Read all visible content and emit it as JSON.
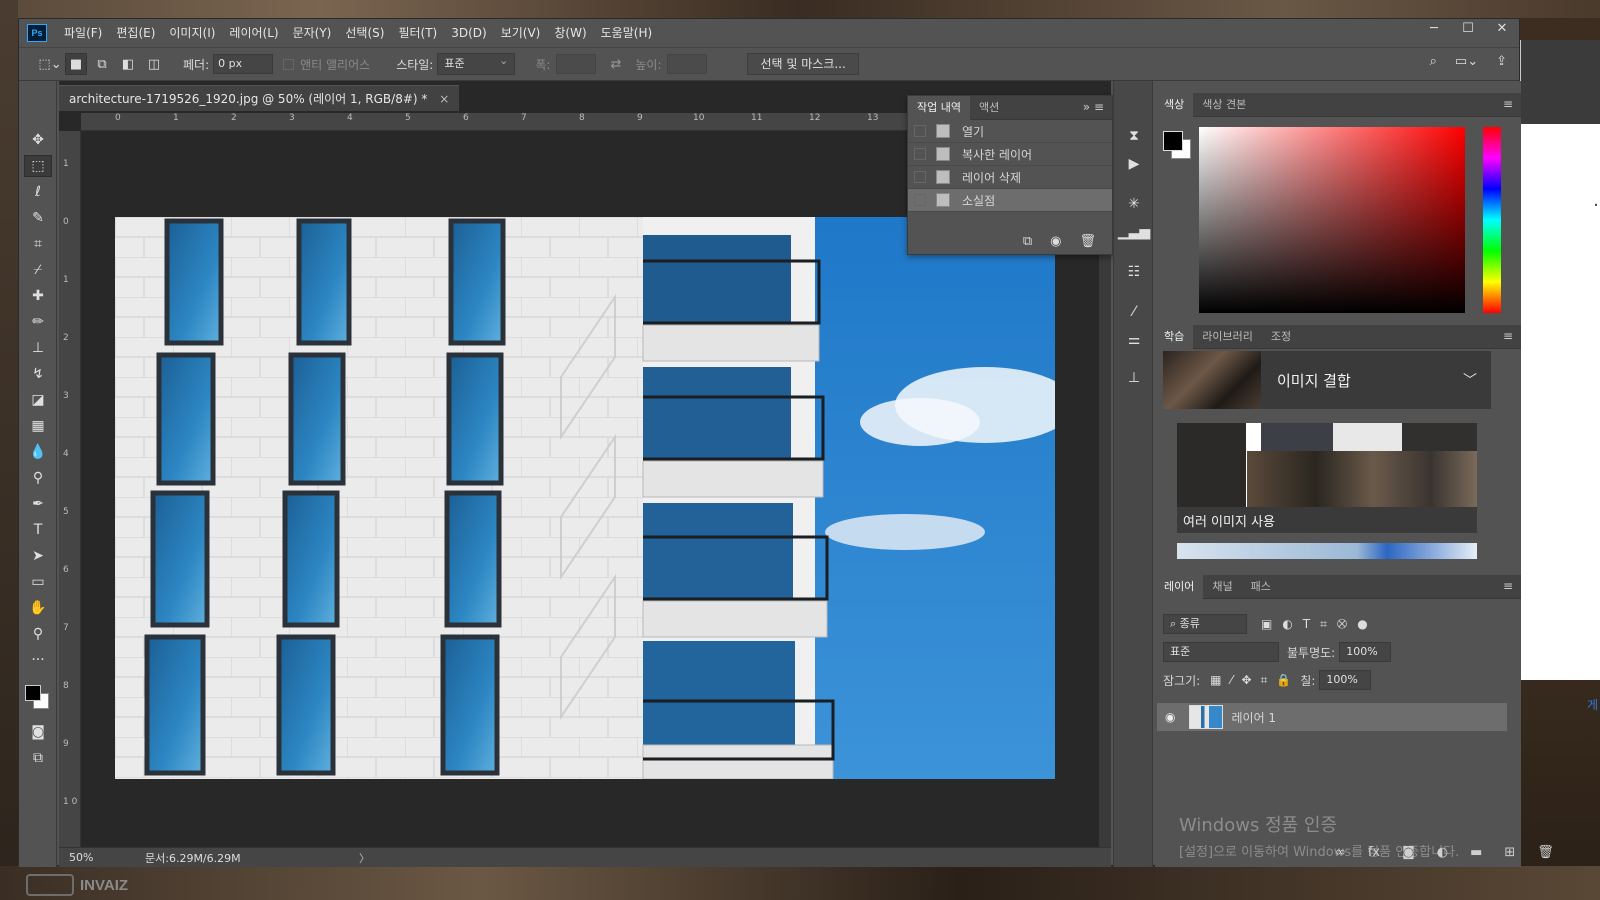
{
  "app": {
    "icon_label": "Ps"
  },
  "menu": [
    "파일(F)",
    "편집(E)",
    "이미지(I)",
    "레이어(L)",
    "문자(Y)",
    "선택(S)",
    "필터(T)",
    "3D(D)",
    "보기(V)",
    "창(W)",
    "도움말(H)"
  ],
  "window_controls": {
    "minimize": "─",
    "maximize": "☐",
    "close": "✕"
  },
  "options": {
    "feather_label": "페더:",
    "feather_value": "0 px",
    "antialias_label": "앤티 앨리어스",
    "style_label": "스타일:",
    "style_value": "표준",
    "width_label": "폭:",
    "height_label": "높이:",
    "select_mask_button": "선택 및 마스크..."
  },
  "document": {
    "tab_title": "architecture-1719526_1920.jpg @ 50% (레이어 1, RGB/8#) *",
    "close": "×",
    "zoom": "50%",
    "doc_size": "문서:6.29M/6.29M",
    "ruler_top": [
      "0",
      "1",
      "2",
      "3",
      "4",
      "5",
      "6",
      "7",
      "8",
      "9",
      "10",
      "11",
      "12",
      "13"
    ],
    "ruler_left": [
      "1",
      "0",
      "1",
      "2",
      "3",
      "4",
      "5",
      "6",
      "7",
      "8",
      "9",
      "1\n0"
    ]
  },
  "history": {
    "tabs": [
      "작업 내역",
      "액션"
    ],
    "items": [
      "열기",
      "복사한 레이어",
      "레이어 삭제",
      "소실점"
    ],
    "selected_index": 3
  },
  "color_panel": {
    "tabs": [
      "색상",
      "색상 견본"
    ],
    "foreground": "#000000",
    "background": "#ffffff",
    "hue": "#ff0000"
  },
  "learn_panel": {
    "tabs": [
      "학습",
      "라이브러리",
      "조정"
    ],
    "section_title": "이미지 결합",
    "card_label": "여러 이미지 사용"
  },
  "layers_panel": {
    "tabs": [
      "레이어",
      "채널",
      "패스"
    ],
    "filter": "종류",
    "blend_mode": "표준",
    "opacity_label": "불투명도:",
    "opacity": "100%",
    "lock_label": "잠그기:",
    "fill_label": "칠:",
    "fill": "100%",
    "layers": [
      {
        "name": "레이어 1",
        "visible": true
      }
    ]
  },
  "windows_activation": {
    "title": "Windows 정품 인증",
    "subtitle": "[설정]으로 이동하여 Windows를 정품 인증합니다."
  },
  "watermark": "INVAIZ",
  "bg_window": {
    "dots": "…",
    "link": "게"
  }
}
